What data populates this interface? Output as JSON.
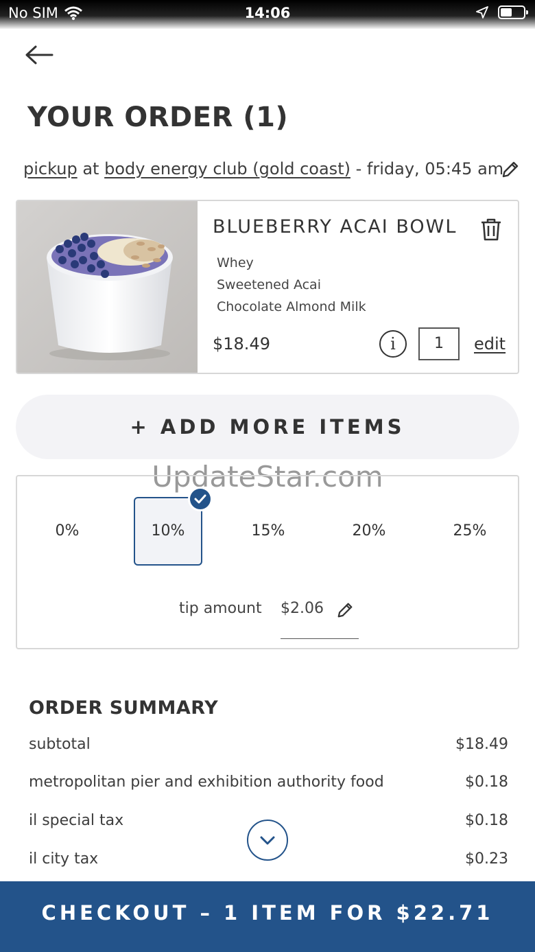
{
  "status": {
    "carrier": "No SIM",
    "time": "14:06"
  },
  "page_title": "YOUR ORDER (1)",
  "pickup": {
    "mode": "pickup",
    "at": "at",
    "location": "body energy club (gold coast)",
    "time": "- friday, 05:45 am"
  },
  "item": {
    "name": "BLUEBERRY ACAI BOWL",
    "modifiers": [
      "Whey",
      "Sweetened Acai",
      "Chocolate Almond Milk"
    ],
    "price": "$18.49",
    "info_label": "i",
    "quantity": "1",
    "edit_label": "edit"
  },
  "add_more_label": "+ ADD MORE ITEMS",
  "watermark": "UpdateStar.com",
  "tip": {
    "options": [
      "0%",
      "10%",
      "15%",
      "20%",
      "25%"
    ],
    "selected": "10%",
    "amount_label": "tip amount",
    "amount_value": "$2.06"
  },
  "summary": {
    "title": "ORDER SUMMARY",
    "rows": [
      {
        "label": "subtotal",
        "value": "$18.49"
      },
      {
        "label": "metropolitan pier and exhibition authority food",
        "value": "$0.18"
      },
      {
        "label": "il special tax",
        "value": "$0.18"
      },
      {
        "label": "il city tax",
        "value": "$0.23"
      }
    ]
  },
  "checkout_label": "CHECKOUT – 1 ITEM FOR $22.71",
  "colors": {
    "accent": "#23538a",
    "card_border": "#d7d7d7",
    "pill_bg": "#f3f3f6"
  }
}
